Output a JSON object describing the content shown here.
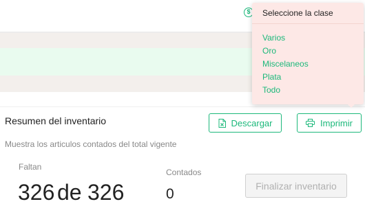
{
  "header": {
    "currency_icon_glyph": "$",
    "trailing_text": "S"
  },
  "inventory": {
    "title": "Resumen del inventario",
    "subtitle": "Muestra los articulos contados del total vigente",
    "download_label": "Descargar",
    "print_label": "Imprimir",
    "faltan_label": "Faltan",
    "remaining": "326",
    "de_label": "de",
    "total": "326",
    "contados_label": "Contados",
    "contados_value": "0",
    "finalize_label": "Finalizar inventario"
  },
  "class_dropdown": {
    "title": "Seleccione la clase",
    "options": [
      "Varios",
      "Oro",
      "Miscelaneos",
      "Plata",
      "Todo"
    ]
  },
  "colors": {
    "accent": "#1bb87a",
    "popover_bg": "#fde8e6",
    "band_green": "#e9fbef",
    "band_gray": "#f3efec"
  }
}
